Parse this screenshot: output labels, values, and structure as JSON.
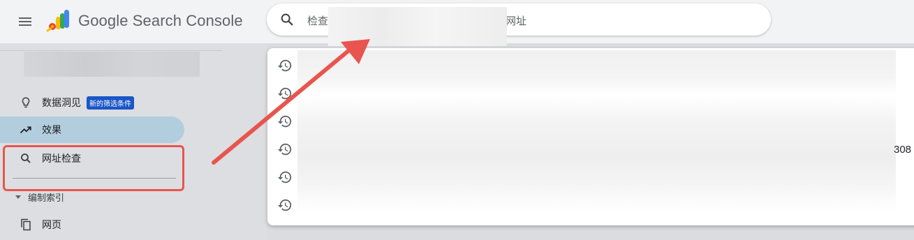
{
  "header": {
    "menu_icon": "hamburger-menu-icon",
    "logo": {
      "icon": "search-console-logo",
      "text": "Google Search Console"
    }
  },
  "search": {
    "icon": "search-icon",
    "placeholder_prefix": "检查",
    "placeholder_suffix": "网址"
  },
  "sidebar": {
    "items": [
      {
        "label": "数据洞见",
        "icon": "lightbulb-icon",
        "badge": "新的筛选条件"
      },
      {
        "label": "效果",
        "icon": "trending-up-icon",
        "active": true
      },
      {
        "label": "网址检查",
        "icon": "search-icon"
      }
    ],
    "section": {
      "label": "编制索引",
      "icon": "triangle-down-icon"
    },
    "section_items": [
      {
        "label": "网页",
        "icon": "pages-icon"
      }
    ]
  },
  "dropdown": {
    "history_icon": "history-icon",
    "row_count": 6,
    "partial_text": "308"
  },
  "colors": {
    "accent_active": "#b2cede",
    "badge": "#1a56c8",
    "annotation": "#e8554e"
  }
}
